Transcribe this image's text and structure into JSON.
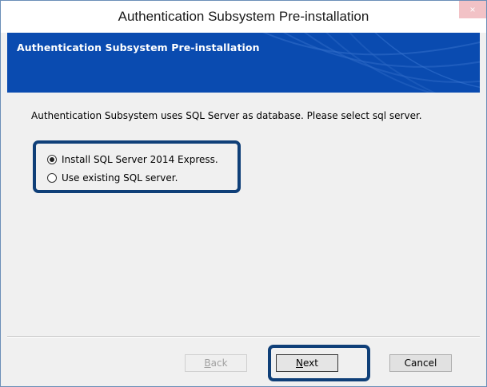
{
  "window": {
    "title": "Authentication Subsystem Pre-installation",
    "close_glyph": "×"
  },
  "banner": {
    "title": "Authentication Subsystem Pre-installation",
    "background_color": "#0a4bb0"
  },
  "body": {
    "description": "Authentication Subsystem uses SQL Server as database. Please select sql server."
  },
  "options": [
    {
      "label": "Install SQL Server 2014 Express.",
      "checked": true
    },
    {
      "label": "Use existing SQL server.",
      "checked": false
    }
  ],
  "buttons": {
    "back": {
      "mnemonic": "B",
      "rest": "ack",
      "enabled": false
    },
    "next": {
      "mnemonic": "N",
      "rest": "ext",
      "enabled": true
    },
    "cancel": {
      "label": "Cancel",
      "enabled": true
    }
  },
  "highlight_color": "#0f3f78"
}
